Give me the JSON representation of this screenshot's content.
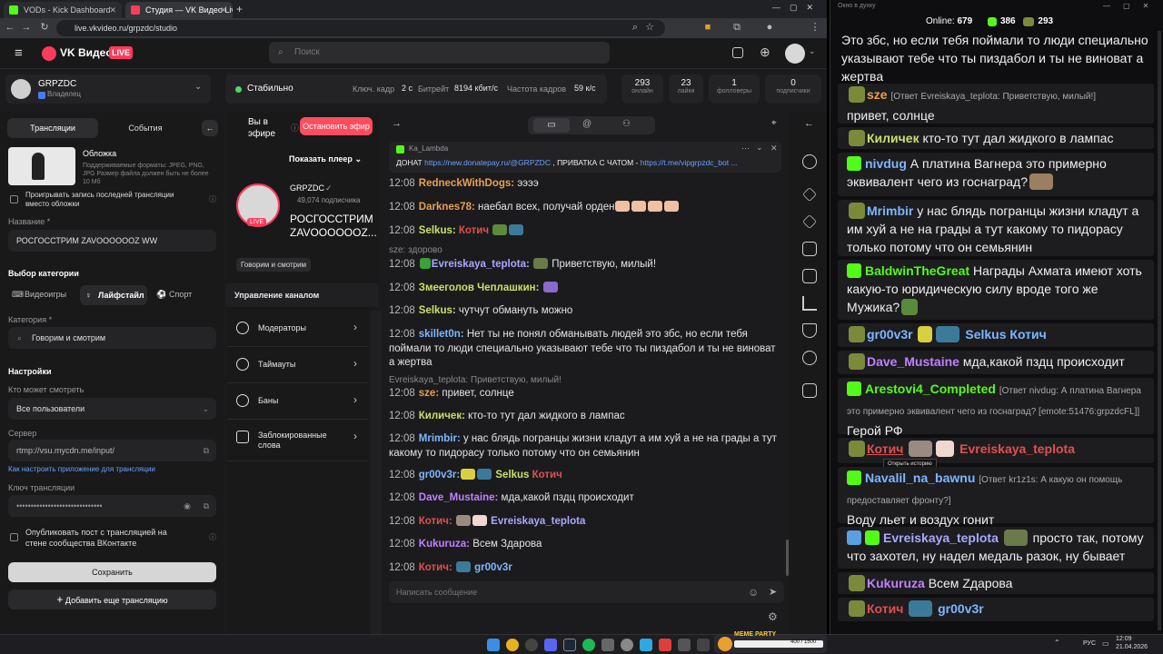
{
  "browser": {
    "tabs": [
      {
        "title": "VODs - Kick Dashboard",
        "color": "#53fc18"
      },
      {
        "title": "Студия — VK Видео Live",
        "color": "#ff3b5c"
      }
    ],
    "url": "live.vkvideo.ru/grpzdc/studio",
    "new_tab": "+"
  },
  "vk": {
    "logo": "VK Видео",
    "live_badge": "LIVE",
    "search_placeholder": "Поиск"
  },
  "channel": {
    "name": "GRPZDC",
    "role": "Владелец"
  },
  "status": {
    "stable": "Стабильно",
    "key_label": "Ключ. кадр",
    "key_value": "2 с",
    "bitrate_label": "Битрейт",
    "bitrate_value": "8194 кбит/с",
    "fps_label": "Частота кадров",
    "fps_value": "59 к/с"
  },
  "stats": [
    {
      "n": "293",
      "t": "онлайн"
    },
    {
      "n": "23",
      "t": "лайки"
    },
    {
      "n": "1",
      "t": "фолловеры"
    },
    {
      "n": "0",
      "t": "подписчики"
    }
  ],
  "left": {
    "tab_broadcasts": "Трансляции",
    "tab_events": "События",
    "cover_title": "Обложка",
    "cover_desc": "Поддерживаемые форматы: JPEG, PNG, JPG Размер файла должен быть не более 10 Мб",
    "replay_checkbox": "Проигрывать запись последней трансляции вместо обложки",
    "name_label": "Название *",
    "name_value": "РОСГОССТРИМ ZAVOOOOOOZ WW",
    "category_heading": "Выбор категории",
    "cat_games": "Видеоигры",
    "cat_life": "Лайфстайл",
    "cat_sport": "Спорт",
    "category_label": "Категория *",
    "category_value": "Говорим и смотрим",
    "settings_heading": "Настройки",
    "who_label": "Кто может смотреть",
    "who_value": "Все пользователи",
    "server_label": "Сервер",
    "server_value": "rtmp://vsu.mycdn.me/input/",
    "howto_link": "Как настроить приложение для трансляции",
    "key_label": "Ключ трансляции",
    "key_value": "••••••••••••••••••••••••••••••",
    "publish_checkbox": "Опубликовать пост с трансляцией на стене сообщества ВКонтакте",
    "save": "Сохранить",
    "add_more": "Добавить еще трансляцию"
  },
  "mid": {
    "on_air": "Вы в эфире",
    "stop_button": "Остановить эфир",
    "show_player": "Показать плеер",
    "channel_name": "GRPZDC",
    "subscribers": "49,074 подписчика",
    "stream_title": "РОСГОССТРИМ ZAVOOOOOOZ...",
    "category_chip": "Говорим и смотрим",
    "manage_heading": "Управление каналом",
    "menu": [
      "Модераторы",
      "Таймауты",
      "Баны",
      "Заблокированные слова"
    ]
  },
  "chat": {
    "pinned_user": "Ka_Lambda",
    "pinned_text_prefix": "ДОНАТ",
    "pinned_link1": "https://new.donatepay.ru/@GRPZDC",
    "pinned_text_mid": ", ПРИВАТКА С ЧАТОМ -",
    "pinned_link2": "https://t.me/vipgrpzdc_bot ...",
    "input_placeholder": "Написать сообщение",
    "messages": [
      {
        "time": "12:08",
        "user": "RedneckWithDogs:",
        "color": "#e8a04e",
        "text": "ээээ"
      },
      {
        "time": "12:08",
        "user": "Darknes78:",
        "color": "#e8a04e",
        "text": "наебал всех, получай орден"
      },
      {
        "time": "12:08",
        "user": "Selkus:",
        "color": "#c9e06a",
        "text": "Котич",
        "text_color": "#e05050"
      },
      {
        "time": "12:08",
        "user": "Evreiskaya_teplota:",
        "color": "#a8a8ff",
        "text": "Приветствую, милый!"
      },
      {
        "time": "12:08",
        "user": "Змееголов Чеплашкин:",
        "color": "#c9e06a",
        "text": ""
      },
      {
        "time": "12:08",
        "user": "Selkus:",
        "color": "#c9e06a",
        "text": "чутчут обмануть можно"
      },
      {
        "time": "12:08",
        "user": "skillet0n:",
        "color": "#7eb6ff",
        "text": "Нет ты не понял обманывать людей это збс, но если тебя поймали то люди специально указывают тебе что ты пиздабол и ты не виноват а жертва"
      },
      {
        "time": "12:08",
        "user": "sze:",
        "color": "#e8a04e",
        "text": "привет, солнце"
      },
      {
        "time": "12:08",
        "user": "Киличек:",
        "color": "#c9e06a",
        "text": "кто-то тут дал жидкого в лампас"
      },
      {
        "time": "12:08",
        "user": "Mrimbir:",
        "color": "#7eb6ff",
        "text": "у нас блядь погранцы жизни кладут а им хуй а не на грады а тут какому то пидорасу только потому что он семьянин"
      },
      {
        "time": "12:08",
        "user": "gr00v3r:",
        "color": "#7eb6ff",
        "text": "Selkus",
        "text2": "Котич"
      },
      {
        "time": "12:08",
        "user": "Dave_Mustaine:",
        "color": "#c080ff",
        "text": "мда,какой пздц происходит"
      },
      {
        "time": "12:08",
        "user": "Котич:",
        "color": "#e05050",
        "text": "Evreiskaya_teplota"
      },
      {
        "time": "12:08",
        "user": "Kukuruza:",
        "color": "#c080ff",
        "text": "Всем Здарова"
      },
      {
        "time": "12:08",
        "user": "Котич:",
        "color": "#e05050",
        "text": "gr00v3r"
      }
    ],
    "reply1": "sze: здорово",
    "reply2": "Evreiskaya_teplota: Приветствую, милый!"
  },
  "right": {
    "window_title": "Окно в духку",
    "online_label": "Online:",
    "online_value": "679",
    "kick_count": "386",
    "vk_count": "293",
    "top_text": "Это збс, но если тебя поймали то люди специально указывают тебе что ты пиздабол и ты не виноват а жертва",
    "messages": [
      {
        "user": "sze",
        "color": "#e8a04e",
        "reply": "[Ответ Evreiskaya_teplota: Приветствую, милый!]",
        "text": "привет, солнце"
      },
      {
        "user": "Киличек",
        "color": "#c9e06a",
        "text": "кто-то тут дал жидкого в лампас"
      },
      {
        "user": "nivdug",
        "color": "#7eb6ff",
        "text": "А платина Вагнера это примерно эквивалент чего из госнаград?"
      },
      {
        "user": "Mrimbir",
        "color": "#7eb6ff",
        "text": "у нас блядь погранцы жизни кладут а им хуй а не на грады а тут какому то пидорасу только потому что он семьянин"
      },
      {
        "user": "BaldwinTheGreat",
        "color": "#53fc18",
        "text": "Награды Ахмата имеют хоть какую-то юридическую силу вроде того же Мужика?"
      },
      {
        "user": "gr00v3r",
        "color": "#7eb6ff",
        "text": "Selkus Котич"
      },
      {
        "user": "Dave_Mustaine",
        "color": "#c080ff",
        "text": "мда,какой пздц происходит"
      },
      {
        "user": "Arestovi4_Completed",
        "color": "#53fc18",
        "reply": "[Ответ nivdug: А платина Вагнера это примерно эквивалент чего из госнаград? [emote:51476:grpzdcFL]]",
        "text": "Герой РФ"
      },
      {
        "user": "Котич",
        "color": "#e05050",
        "text": "Evreiskaya_teplota"
      },
      {
        "user": "Navalil_na_bawnu",
        "color": "#7eb6ff",
        "reply": "[Ответ kr1z1s: А какую он помощь предоставляет фронту?]",
        "text": "Воду льет и воздух гонит"
      },
      {
        "user": "Evreiskaya_teplota",
        "color": "#a8a8ff",
        "text": "просто так, потому что захотел, ну надел медаль разок, ну бывает"
      },
      {
        "user": "Kukuruza",
        "color": "#c080ff",
        "text": "Всем Zдарова"
      },
      {
        "user": "Котич",
        "color": "#e05050",
        "text": "gr00v3r"
      }
    ],
    "tooltip": "Открыть историю"
  },
  "taskbar": {
    "media_title": "MEME PARTY",
    "media_progress": "400 / 1500",
    "lang": "РУС",
    "time": "12:09",
    "date": "21.04.2026"
  }
}
